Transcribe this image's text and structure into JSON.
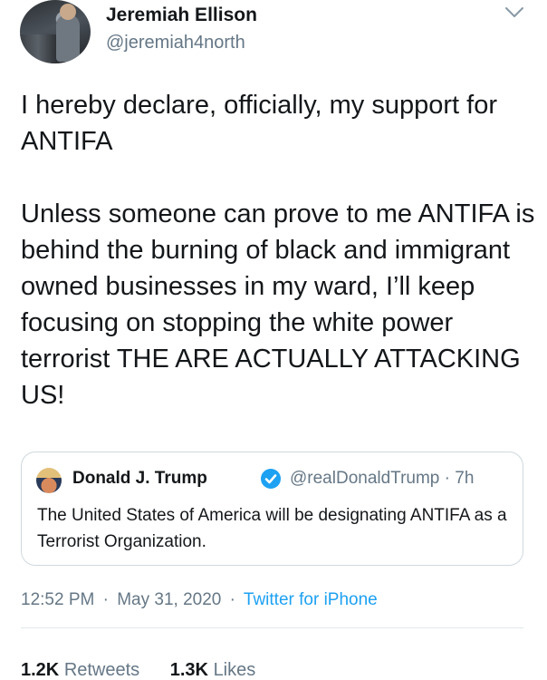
{
  "author": {
    "name": "Jeremiah Ellison",
    "handle": "@jeremiah4north"
  },
  "tweet": {
    "paragraphs": [
      "I hereby declare, officially, my support for ANTIFA",
      "Unless someone can prove to me ANTIFA is behind the burning of black and immigrant owned businesses in my ward, I’ll keep focusing on stopping the white power terrorist THE ARE ACTUALLY ATTACKING US!"
    ]
  },
  "quoted_tweet": {
    "name": "Donald J. Trump",
    "handle": "@realDonaldTrump",
    "separator": "·",
    "time": "7h",
    "text": "The United States of America will be designating ANTIFA as a Terrorist Organization."
  },
  "meta": {
    "time": "12:52 PM",
    "separator": "·",
    "date": "May 31, 2020",
    "source": "Twitter for iPhone"
  },
  "stats": {
    "retweets_count": "1.2K",
    "retweets_label": "Retweets",
    "likes_count": "1.3K",
    "likes_label": "Likes"
  },
  "icons": {
    "menu": "chevron-down-icon",
    "verified": "verified-badge-icon"
  },
  "colors": {
    "link_blue": "#1da1f2",
    "secondary_text": "#657786",
    "border": "#cfd9de"
  }
}
